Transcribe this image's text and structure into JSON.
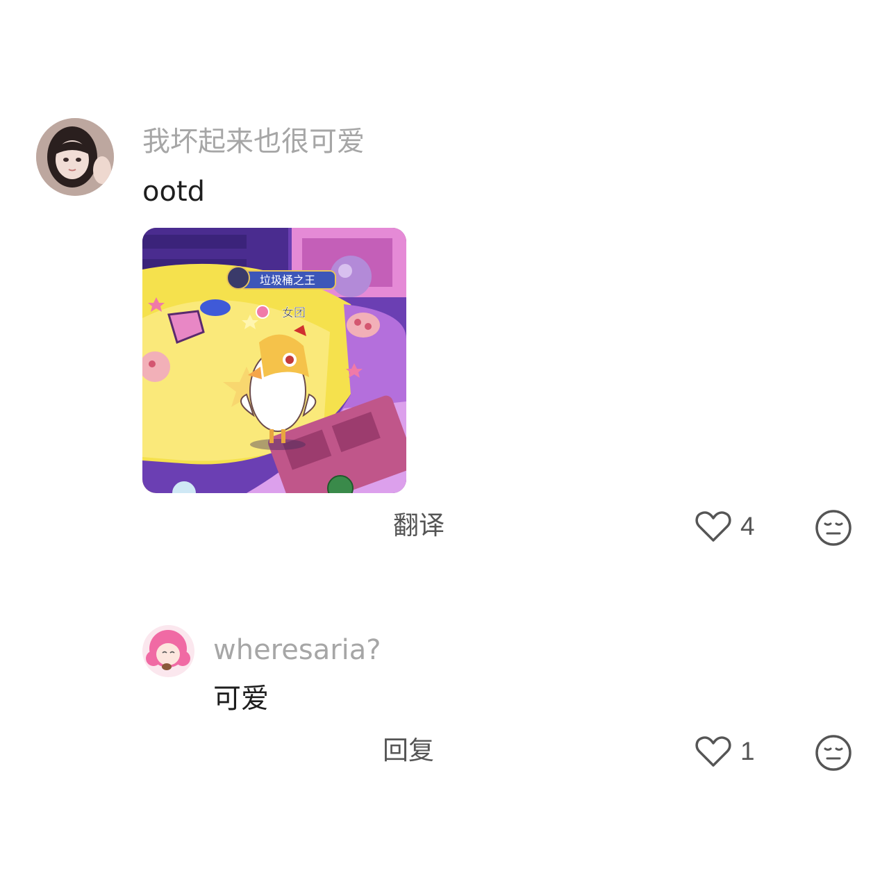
{
  "comment": {
    "username": "我坏起来也很可爱",
    "text": "ootd",
    "image": {
      "banner_label": "垃圾桶之王",
      "tag_label": "女团"
    },
    "translate_label": "翻译",
    "like_count": "4",
    "icons": {
      "like": "heart-outline-icon",
      "dislike": "unamused-face-icon"
    }
  },
  "reply": {
    "username": "wheresaria?",
    "text": "可爱",
    "reply_label": "回复",
    "like_count": "1",
    "icons": {
      "like": "heart-outline-icon",
      "dislike": "unamused-face-icon"
    }
  }
}
